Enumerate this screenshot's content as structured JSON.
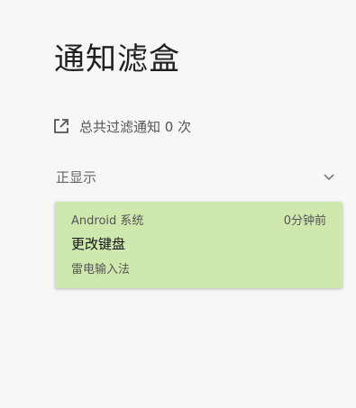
{
  "page": {
    "title": "通知滤盒"
  },
  "stats": {
    "filtered_text": "总共过滤通知 0 次",
    "icon": "open-in-new-icon"
  },
  "section": {
    "label": "正显示",
    "toggle_icon": "chevron-down-icon"
  },
  "notifications": [
    {
      "source": "Android 系统",
      "time": "0分钟前",
      "title": "更改键盘",
      "body": "雷电输入法",
      "background": "#cfe8ad"
    }
  ]
}
